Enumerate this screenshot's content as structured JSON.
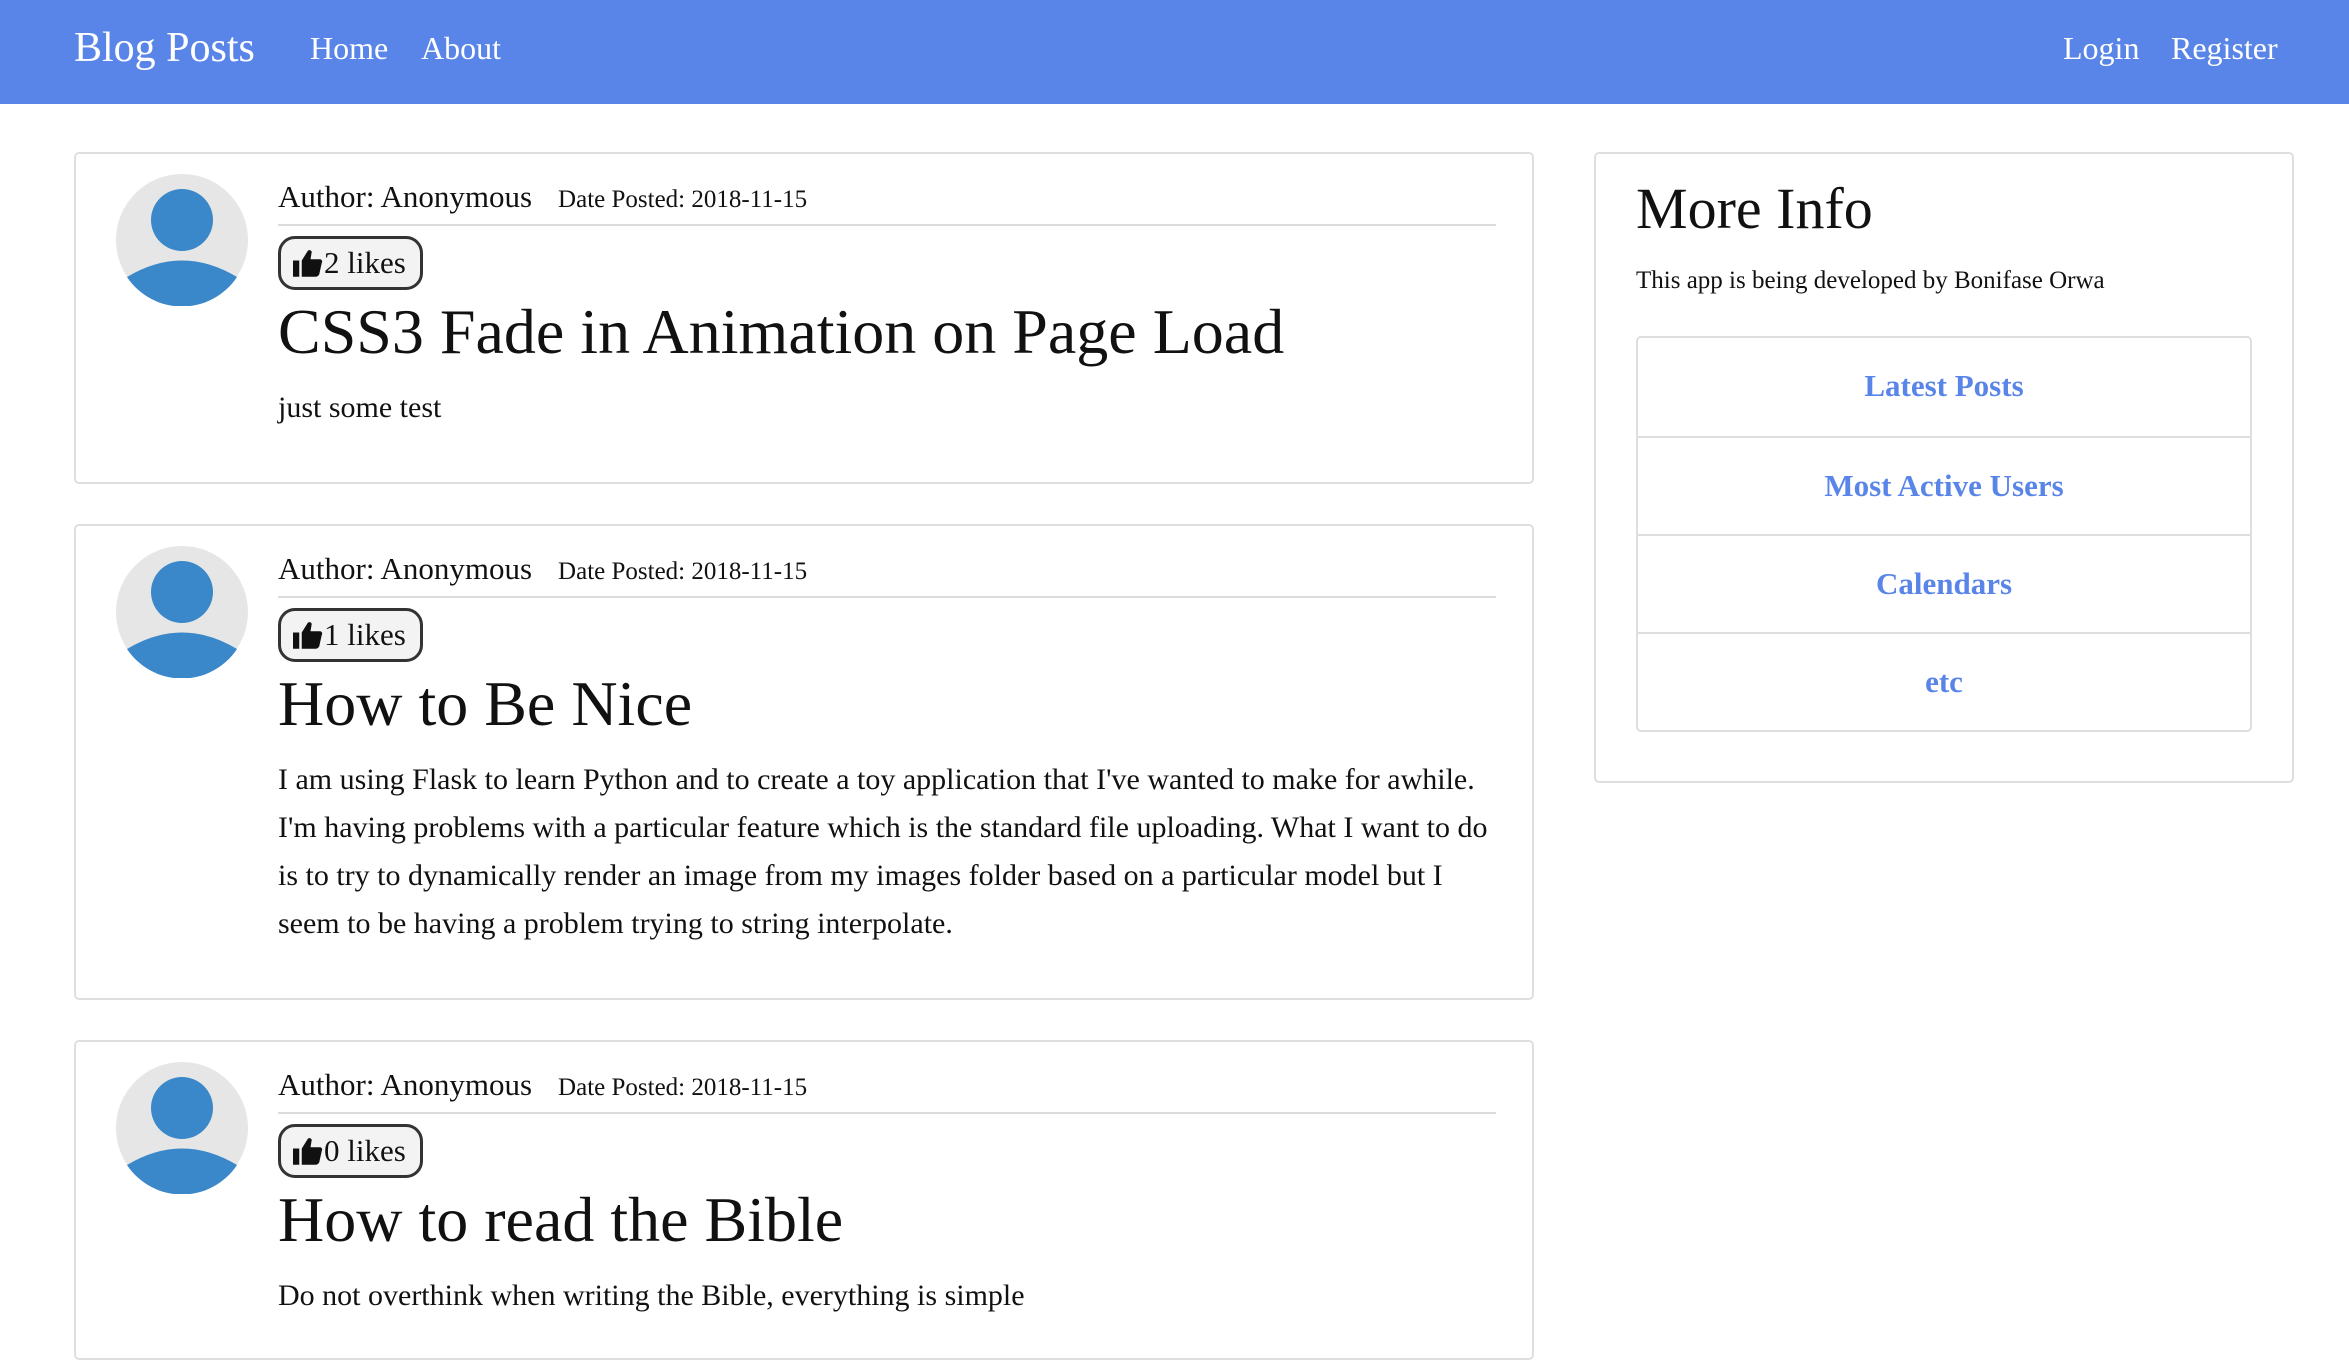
{
  "navbar": {
    "brand": "Blog Posts",
    "links": [
      {
        "label": "Home"
      },
      {
        "label": "About"
      },
      {
        "label": "Login"
      },
      {
        "label": "Register"
      }
    ]
  },
  "colors": {
    "navbar_background": "#5a85e8",
    "link_color": "#5a85e8",
    "avatar_blue": "#3a87c9",
    "avatar_background": "#e6e6e6"
  },
  "icons": {
    "avatar": "user-avatar-icon",
    "like": "thumbs-up-icon"
  },
  "posts": [
    {
      "author": "Author: Anonymous",
      "date": "Date Posted: 2018-11-15",
      "likes": "2 likes",
      "title": "CSS3 Fade in Animation on Page Load",
      "content": "just some test"
    },
    {
      "author": "Author: Anonymous",
      "date": "Date Posted: 2018-11-15",
      "likes": "1 likes",
      "title": "How to Be Nice",
      "content": "I am using Flask to learn Python and to create a toy application that I've wanted to make for awhile. I'm having problems with a particular feature which is the standard file uploading. What I want to do is to try to dynamically render an image from my images folder based on a particular model but I seem to be having a problem trying to string interpolate."
    },
    {
      "author": "Author: Anonymous",
      "date": "Date Posted: 2018-11-15",
      "likes": "0 likes",
      "title": "How to read the Bible",
      "content": "Do not overthink when writing the Bible, everything is simple"
    }
  ],
  "sidebar": {
    "title": "More Info",
    "description": "This app is being developed by Bonifase Orwa",
    "links": [
      {
        "label": "Latest Posts"
      },
      {
        "label": "Most Active Users"
      },
      {
        "label": "Calendars"
      },
      {
        "label": "etc"
      }
    ]
  }
}
